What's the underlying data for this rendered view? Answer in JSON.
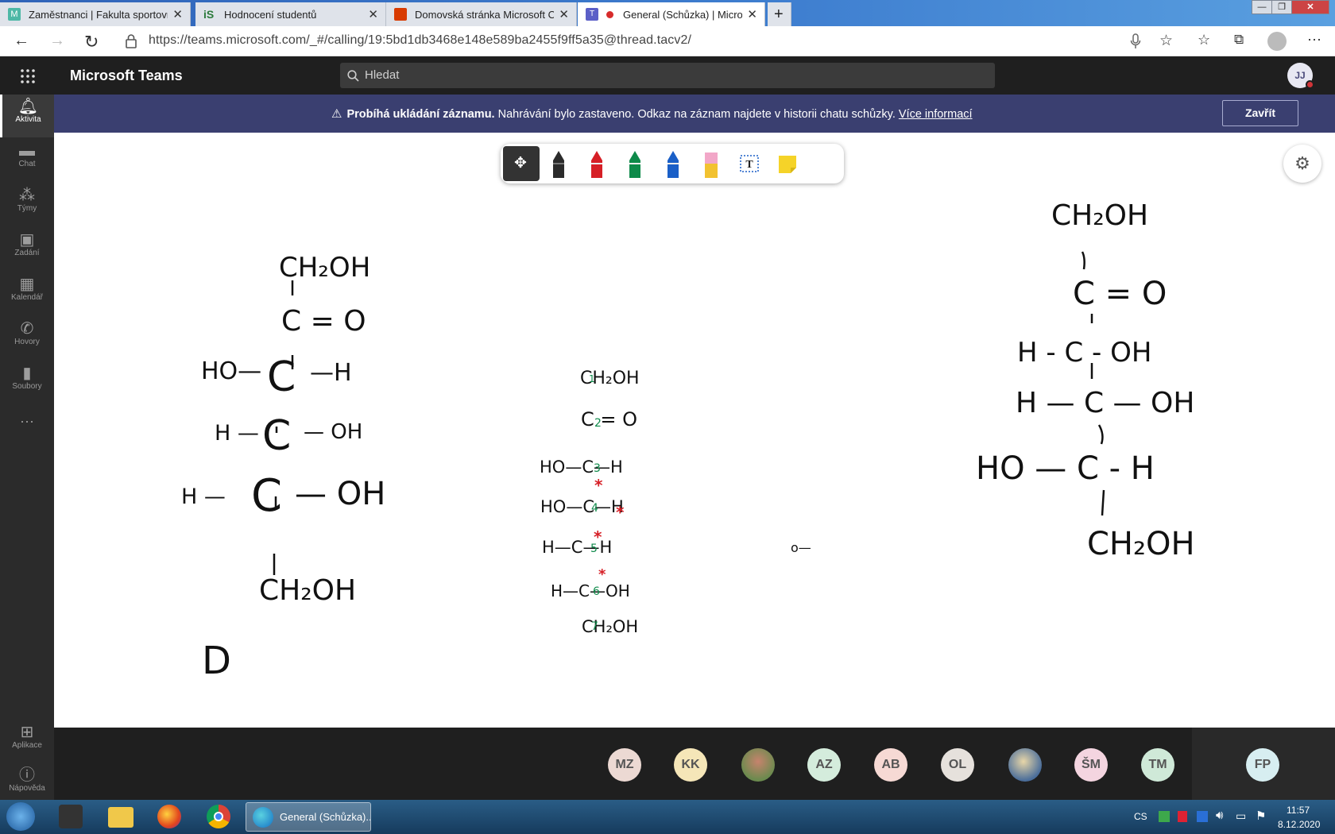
{
  "browser": {
    "tabs": [
      {
        "title": "Zaměstnanci | Fakulta sportovníc",
        "icon": "teal-m-icon",
        "color": "#4db8a6"
      },
      {
        "title": "Hodnocení studentů",
        "icon": "is-logo-icon",
        "color": "#2b7a3b"
      },
      {
        "title": "Domovská stránka Microsoft Off",
        "icon": "office-icon",
        "color": "#d83b01"
      },
      {
        "title": "General (Schůzka) | Microso",
        "icon": "teams-icon",
        "color": "#5b5fc7"
      }
    ],
    "url": "https://teams.microsoft.com/_#/calling/19:5bd1db3468e148e589ba2455f9ff5a35@thread.tacv2/"
  },
  "teams": {
    "app_title": "Microsoft Teams",
    "search_placeholder": "Hledat",
    "user_initials": "JJ"
  },
  "rail": [
    {
      "label": "Aktivita",
      "icon": "bell-icon",
      "active": true
    },
    {
      "label": "Chat",
      "icon": "chat-icon"
    },
    {
      "label": "Týmy",
      "icon": "teams-people-icon"
    },
    {
      "label": "Zadání",
      "icon": "assignment-icon"
    },
    {
      "label": "Kalendář",
      "icon": "calendar-icon"
    },
    {
      "label": "Hovory",
      "icon": "phone-icon"
    },
    {
      "label": "Soubory",
      "icon": "file-icon"
    },
    {
      "label": "Aplikace",
      "icon": "apps-icon"
    },
    {
      "label": "Nápověda",
      "icon": "help-icon"
    }
  ],
  "banner": {
    "bold": "Probíhá ukládání záznamu.",
    "text": "Nahrávání bylo zastaveno. Odkaz na záznam najdete v historii chatu schůzky.",
    "link": "Více informací",
    "close": "Zavřít"
  },
  "board": {
    "left": {
      "l1": "CH₂OH",
      "l2": "C = O",
      "l3a": "HO—",
      "l3c": "C",
      "l3b": "—H",
      "l4a": "H —",
      "l4c": "C",
      "l4b": "— OH",
      "l5a": "H —",
      "l5c": "C",
      "l5b": "— OH",
      "l6": "CH₂OH",
      "l7": "D"
    },
    "middle": {
      "l1": "CH₂OH",
      "l2": "C = O",
      "l3": "HO—C—H",
      "l4": "HO—C—H",
      "l5": "H—C—H",
      "l6": "H—C—OH",
      "l7": "CH₂OH",
      "nums": [
        "1",
        "2",
        "3",
        "4",
        "5",
        "6",
        "7"
      ],
      "stars": [
        "*",
        "*",
        "*",
        "*"
      ],
      "stray": "o—"
    },
    "right": {
      "l1": "CH₂OH",
      "l2": "C = O",
      "l3": "H - C - OH",
      "l4": "H — C — OH",
      "l5": "HO — C - H",
      "l6": "CH₂OH"
    }
  },
  "participants": [
    "MZ",
    "KK",
    "photo-1",
    "AZ",
    "AB",
    "OL",
    "photo-2",
    "ŠM",
    "TM",
    "FP"
  ],
  "taskbar": {
    "active_window": "General (Schůzka)...",
    "lang": "CS",
    "time": "11:57",
    "date": "8.12.2020"
  }
}
